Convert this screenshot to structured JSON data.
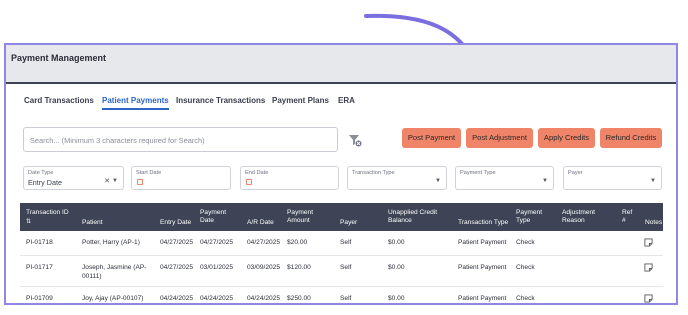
{
  "header": {
    "title": "Payment Management"
  },
  "tabs": [
    {
      "label": "Card Transactions",
      "active": false
    },
    {
      "label": "Patient Payments",
      "active": true
    },
    {
      "label": "Insurance Transactions",
      "active": false
    },
    {
      "label": "Payment Plans",
      "active": false
    },
    {
      "label": "ERA",
      "active": false
    }
  ],
  "search": {
    "placeholder": "Search... (Minimum 3 characters required for Search)"
  },
  "actions": {
    "post_payment": "Post Payment",
    "post_adjustment": "Post Adjustment",
    "apply_credits": "Apply Credits",
    "refund_credits": "Refund Credits"
  },
  "filters": {
    "date_type": {
      "label": "Date Type",
      "value": "Entry Date"
    },
    "start_date": {
      "label": "Start Date"
    },
    "end_date": {
      "label": "End Date"
    },
    "transaction_type": {
      "label": "Transaction Type"
    },
    "payment_type": {
      "label": "Payment Type"
    },
    "payer": {
      "label": "Payer"
    }
  },
  "table": {
    "columns": {
      "transaction_id": "Transaction ID",
      "patient": "Patient",
      "entry_date": "Entry Date",
      "payment_date": "Payment Date",
      "ar_date": "A/R Date",
      "payment_amount": "Payment Amount",
      "payer": "Payer",
      "unapplied": "Unapplied Credit Balance",
      "transaction_type": "Transaction Type",
      "payment_type": "Payment Type",
      "adjustment_reason": "Adjustment Reason",
      "ref": "Ref #",
      "notes": "Notes"
    },
    "rows": [
      {
        "id": "PI-01718",
        "patient": "Potter, Harry (AP-1)",
        "entry": "04/27/2025",
        "payment": "04/27/2025",
        "ar": "04/27/2025",
        "amount": "$20.00",
        "payer": "Self",
        "unapplied": "$0.00",
        "ttype": "Patient Payment",
        "ptype": "Check"
      },
      {
        "id": "PI-01717",
        "patient": "Joseph, Jasmine (AP-00111)",
        "entry": "04/27/2025",
        "payment": "03/01/2025",
        "ar": "03/09/2025",
        "amount": "$120.00",
        "payer": "Self",
        "unapplied": "$0.00",
        "ttype": "Patient Payment",
        "ptype": "Check"
      },
      {
        "id": "PI-01709",
        "patient": "Joy, Ajay (AP-00107)",
        "entry": "04/24/2025",
        "payment": "04/24/2025",
        "ar": "04/24/2025",
        "amount": "$250.00",
        "payer": "Self",
        "unapplied": "$0.00",
        "ttype": "Patient Payment",
        "ptype": "Check"
      }
    ]
  },
  "colors": {
    "accent": "#2c65c4",
    "button": "#f08468",
    "header_bg": "#3e4456",
    "frame": "#8f86e8",
    "arrow": "#7b6fe0"
  }
}
